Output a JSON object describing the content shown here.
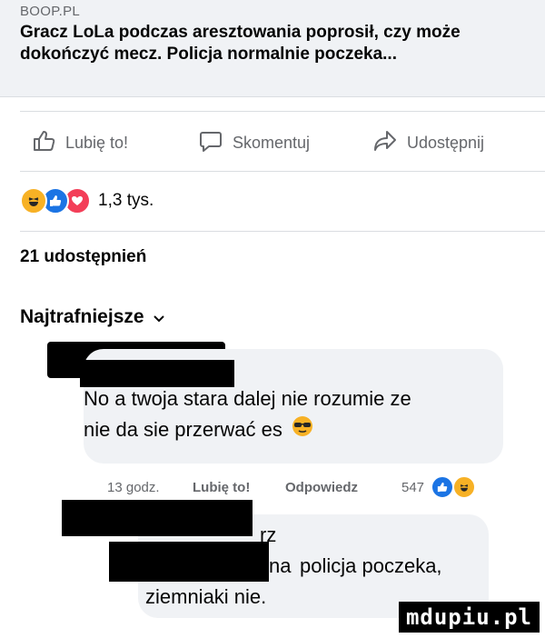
{
  "post": {
    "source": "BOOP.PL",
    "headline": "Gracz LoLa podczas aresztowania poprosił, czy może dokończyć mecz. Policja normalnie poczeka..."
  },
  "actions": {
    "like": {
      "label": "Lubię to!",
      "icon": "thumbs-up-icon"
    },
    "comment": {
      "label": "Skomentuj",
      "icon": "speech-bubble-icon"
    },
    "share": {
      "label": "Udostępnij",
      "icon": "share-arrow-icon"
    }
  },
  "reactions": {
    "icons": [
      "haha-icon",
      "like-icon",
      "love-icon"
    ],
    "count": "1,3 tys."
  },
  "shares": "21 udostępnień",
  "sort_label": "Najtrafniejsze",
  "comments": [
    {
      "text_line1": "No a twoja stara dalej nie rozumie ze",
      "text_line2": "nie da sie przerwać es",
      "emoji": "sunglasses-emoji-icon",
      "time": "13 godz.",
      "like_label": "Lubię to!",
      "reply_label": "Odpowiedz",
      "reaction_count": "547"
    },
    {
      "fragment_top": "rz",
      "fragment_mid": "na",
      "text_line1_rest": "policja poczeka,",
      "text_line2": "ziemniaki nie."
    }
  ],
  "watermark": "mdupiu.pl",
  "colors": {
    "preview_bg": "#f0f2f5",
    "secondary_text": "#65676b",
    "like_blue": "#1b74e4",
    "love_red": "#f33e58",
    "haha_yellow": "#f7b125"
  }
}
